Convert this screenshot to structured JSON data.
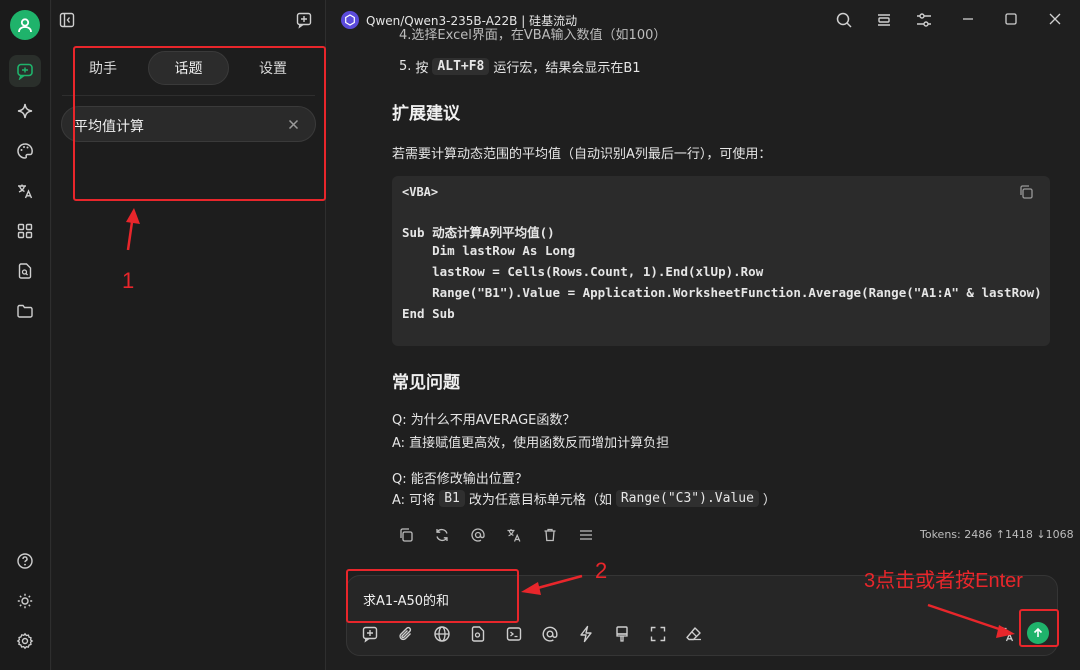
{
  "window": {
    "model_title": "Qwen/Qwen3-235B-A22B | 硅基流动"
  },
  "sidebar": {
    "tabs": [
      {
        "label": "助手",
        "active": false
      },
      {
        "label": "话题",
        "active": true
      },
      {
        "label": "设置",
        "active": false
      }
    ],
    "topic_item": "平均值计算"
  },
  "message": {
    "cut_off_line": "4.选择Excel界面，在VBA输入数值（如100）",
    "step5_prefix": "5.",
    "step5_press": "按",
    "step5_key": "ALT+F8",
    "step5_rest": "运行宏，结果会显示在B1",
    "section_extend": "扩展建议",
    "extend_text": "若需要计算动态范围的平均值（自动识别A列最后一行），可使用：",
    "code_lang": "<VBA>",
    "code_lines": [
      "Sub 动态计算A列平均值()",
      "    Dim lastRow As Long",
      "    lastRow = Cells(Rows.Count, 1).End(xlUp).Row",
      "    Range(\"B1\").Value = Application.WorksheetFunction.Average(Range(\"A1:A\" & lastRow)",
      "End Sub"
    ],
    "section_faq": "常见问题",
    "q1": "Q: 为什么不用AVERAGE函数？",
    "a1": "A: 直接赋值更高效，使用函数反而增加计算负担",
    "q2": "Q: 能否修改输出位置？",
    "a2_prefix": "A: 可将",
    "a2_code1": "B1",
    "a2_mid": "改为任意目标单元格（如",
    "a2_code2": "Range(\"C3\").Value",
    "a2_suffix": "）",
    "tokens": "Tokens: 2486 ↑1418 ↓1068"
  },
  "input": {
    "value": "求A1-A50的和"
  },
  "annotations": {
    "label1": "1",
    "label2": "2",
    "label3": "3点击或者按Enter"
  },
  "colors": {
    "accent_green": "#1fb36b",
    "annotation_red": "#e8262b"
  }
}
